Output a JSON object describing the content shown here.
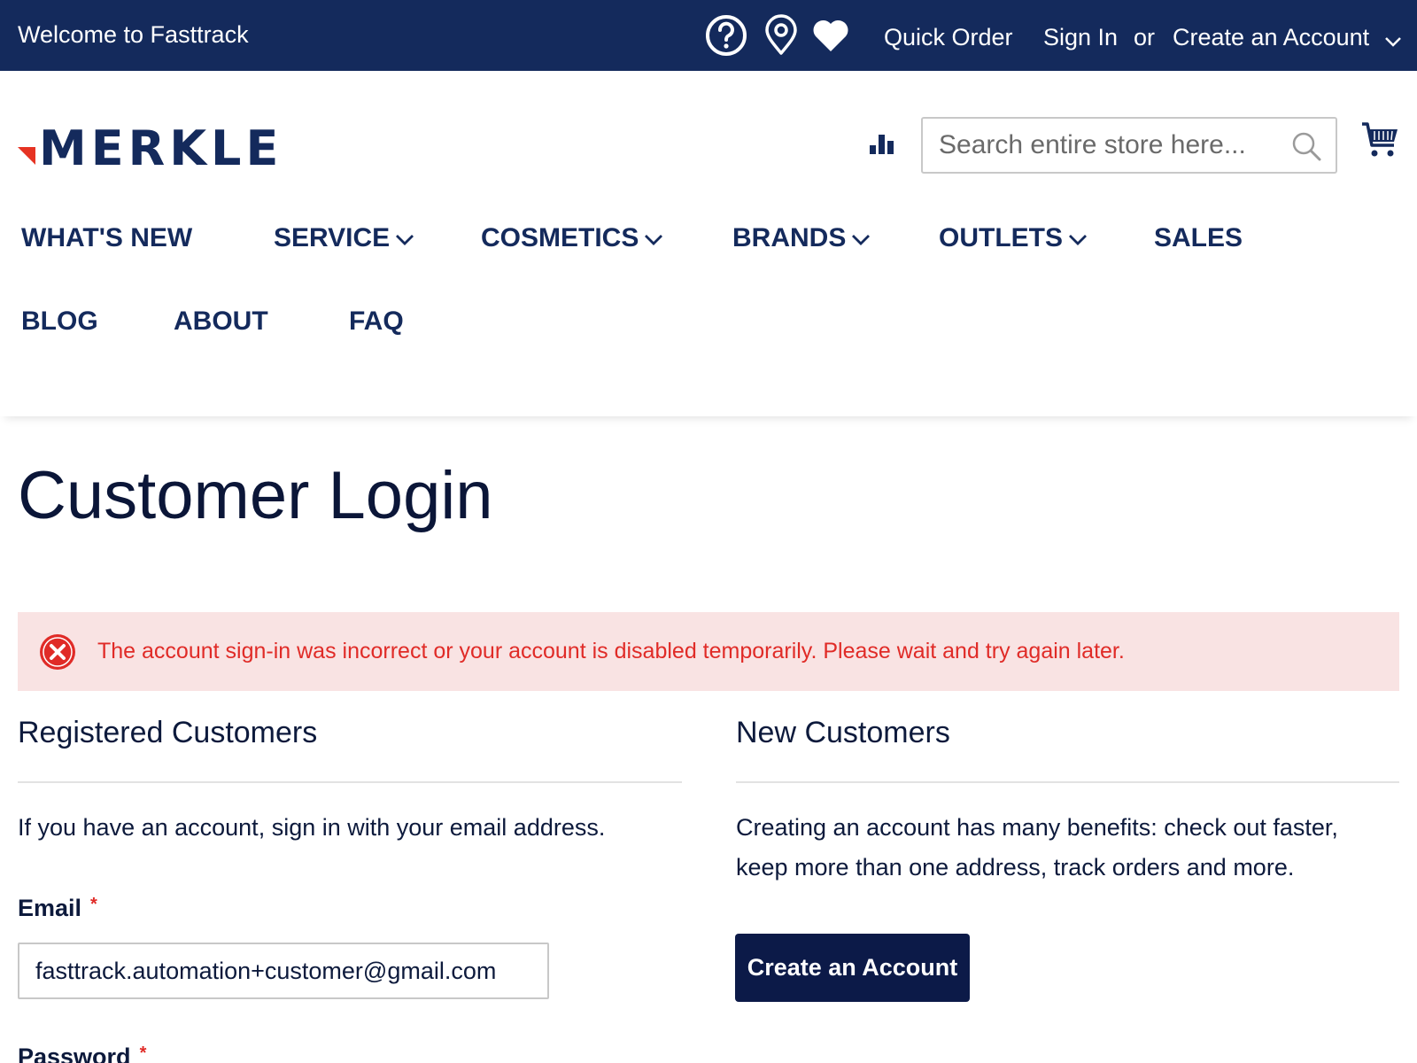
{
  "topbar": {
    "welcome": "Welcome to Fasttrack",
    "quick_order": "Quick Order",
    "sign_in": "Sign In",
    "or": "or",
    "create_account": "Create an Account",
    "background_color": "#142a5c"
  },
  "header": {
    "logo_text": "MERKLE",
    "search_placeholder": "Search entire store here...",
    "brand_color": "#142a5c",
    "accent_color": "#e63323"
  },
  "nav": {
    "items": [
      {
        "label": "WHAT'S NEW",
        "has_dropdown": false
      },
      {
        "label": "SERVICE",
        "has_dropdown": true
      },
      {
        "label": "COSMETICS",
        "has_dropdown": true
      },
      {
        "label": "BRANDS",
        "has_dropdown": true
      },
      {
        "label": "OUTLETS",
        "has_dropdown": true
      },
      {
        "label": "SALES",
        "has_dropdown": false
      },
      {
        "label": "BLOG",
        "has_dropdown": false
      },
      {
        "label": "ABOUT",
        "has_dropdown": false
      },
      {
        "label": "FAQ",
        "has_dropdown": false
      }
    ]
  },
  "page": {
    "title": "Customer Login"
  },
  "error": {
    "message": "The account sign-in was incorrect or your account is disabled temporarily. Please wait and try again later.",
    "color": "#e02b27",
    "background": "#f9e3e3"
  },
  "registered": {
    "title": "Registered Customers",
    "intro": "If you have an account, sign in with your email address.",
    "email_label": "Email",
    "email_value": "fasttrack.automation+customer@gmail.com",
    "password_label": "Password",
    "required_mark": "*"
  },
  "new_customers": {
    "title": "New Customers",
    "intro": "Creating an account has many benefits: check out faster, keep more than one address, track orders and more.",
    "button_label": "Create an Account"
  }
}
